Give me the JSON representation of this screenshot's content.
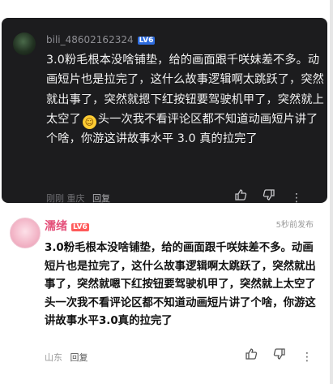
{
  "dark_comment": {
    "username": "bili_48602162324",
    "level": "LV6",
    "text_before_emoji": "3.0粉毛根本没啥铺垫，给的画面跟千咲妹差不多。动画短片也是拉完了，这什么故事逻辑啊太跳跃了，突然就出事了，突然就摁下红按钮要驾驶机甲了，突然就上太空了",
    "text_after_emoji": "头一次我不看评论区都不知道动画短片讲了个啥，你游这讲故事水平 3.0 真的拉完了",
    "location": "刚刚  重庆",
    "reply": "回复",
    "icons": [
      "thumbs-up-icon",
      "thumbs-down-icon",
      "more-icon"
    ]
  },
  "light_comment": {
    "username": "濡绪",
    "level": "LV6",
    "time": "5秒前发布",
    "text": "3.0粉毛根本没啥铺垫，给的画面跟千咲妹差不多。动画短片也是拉完了，这什么故事逻辑啊太跳跃了，突然就出事了，突然就嗯下红按钮要驾驶机甲了，突然就上太空了头一次我不看评论区都不知道动画短片讲了个啥，你游这讲故事水平3.0真的拉完了",
    "location": "山东",
    "reply": "回复",
    "icons": [
      "thumbs-up-icon",
      "thumbs-down-icon",
      "more-icon"
    ]
  }
}
